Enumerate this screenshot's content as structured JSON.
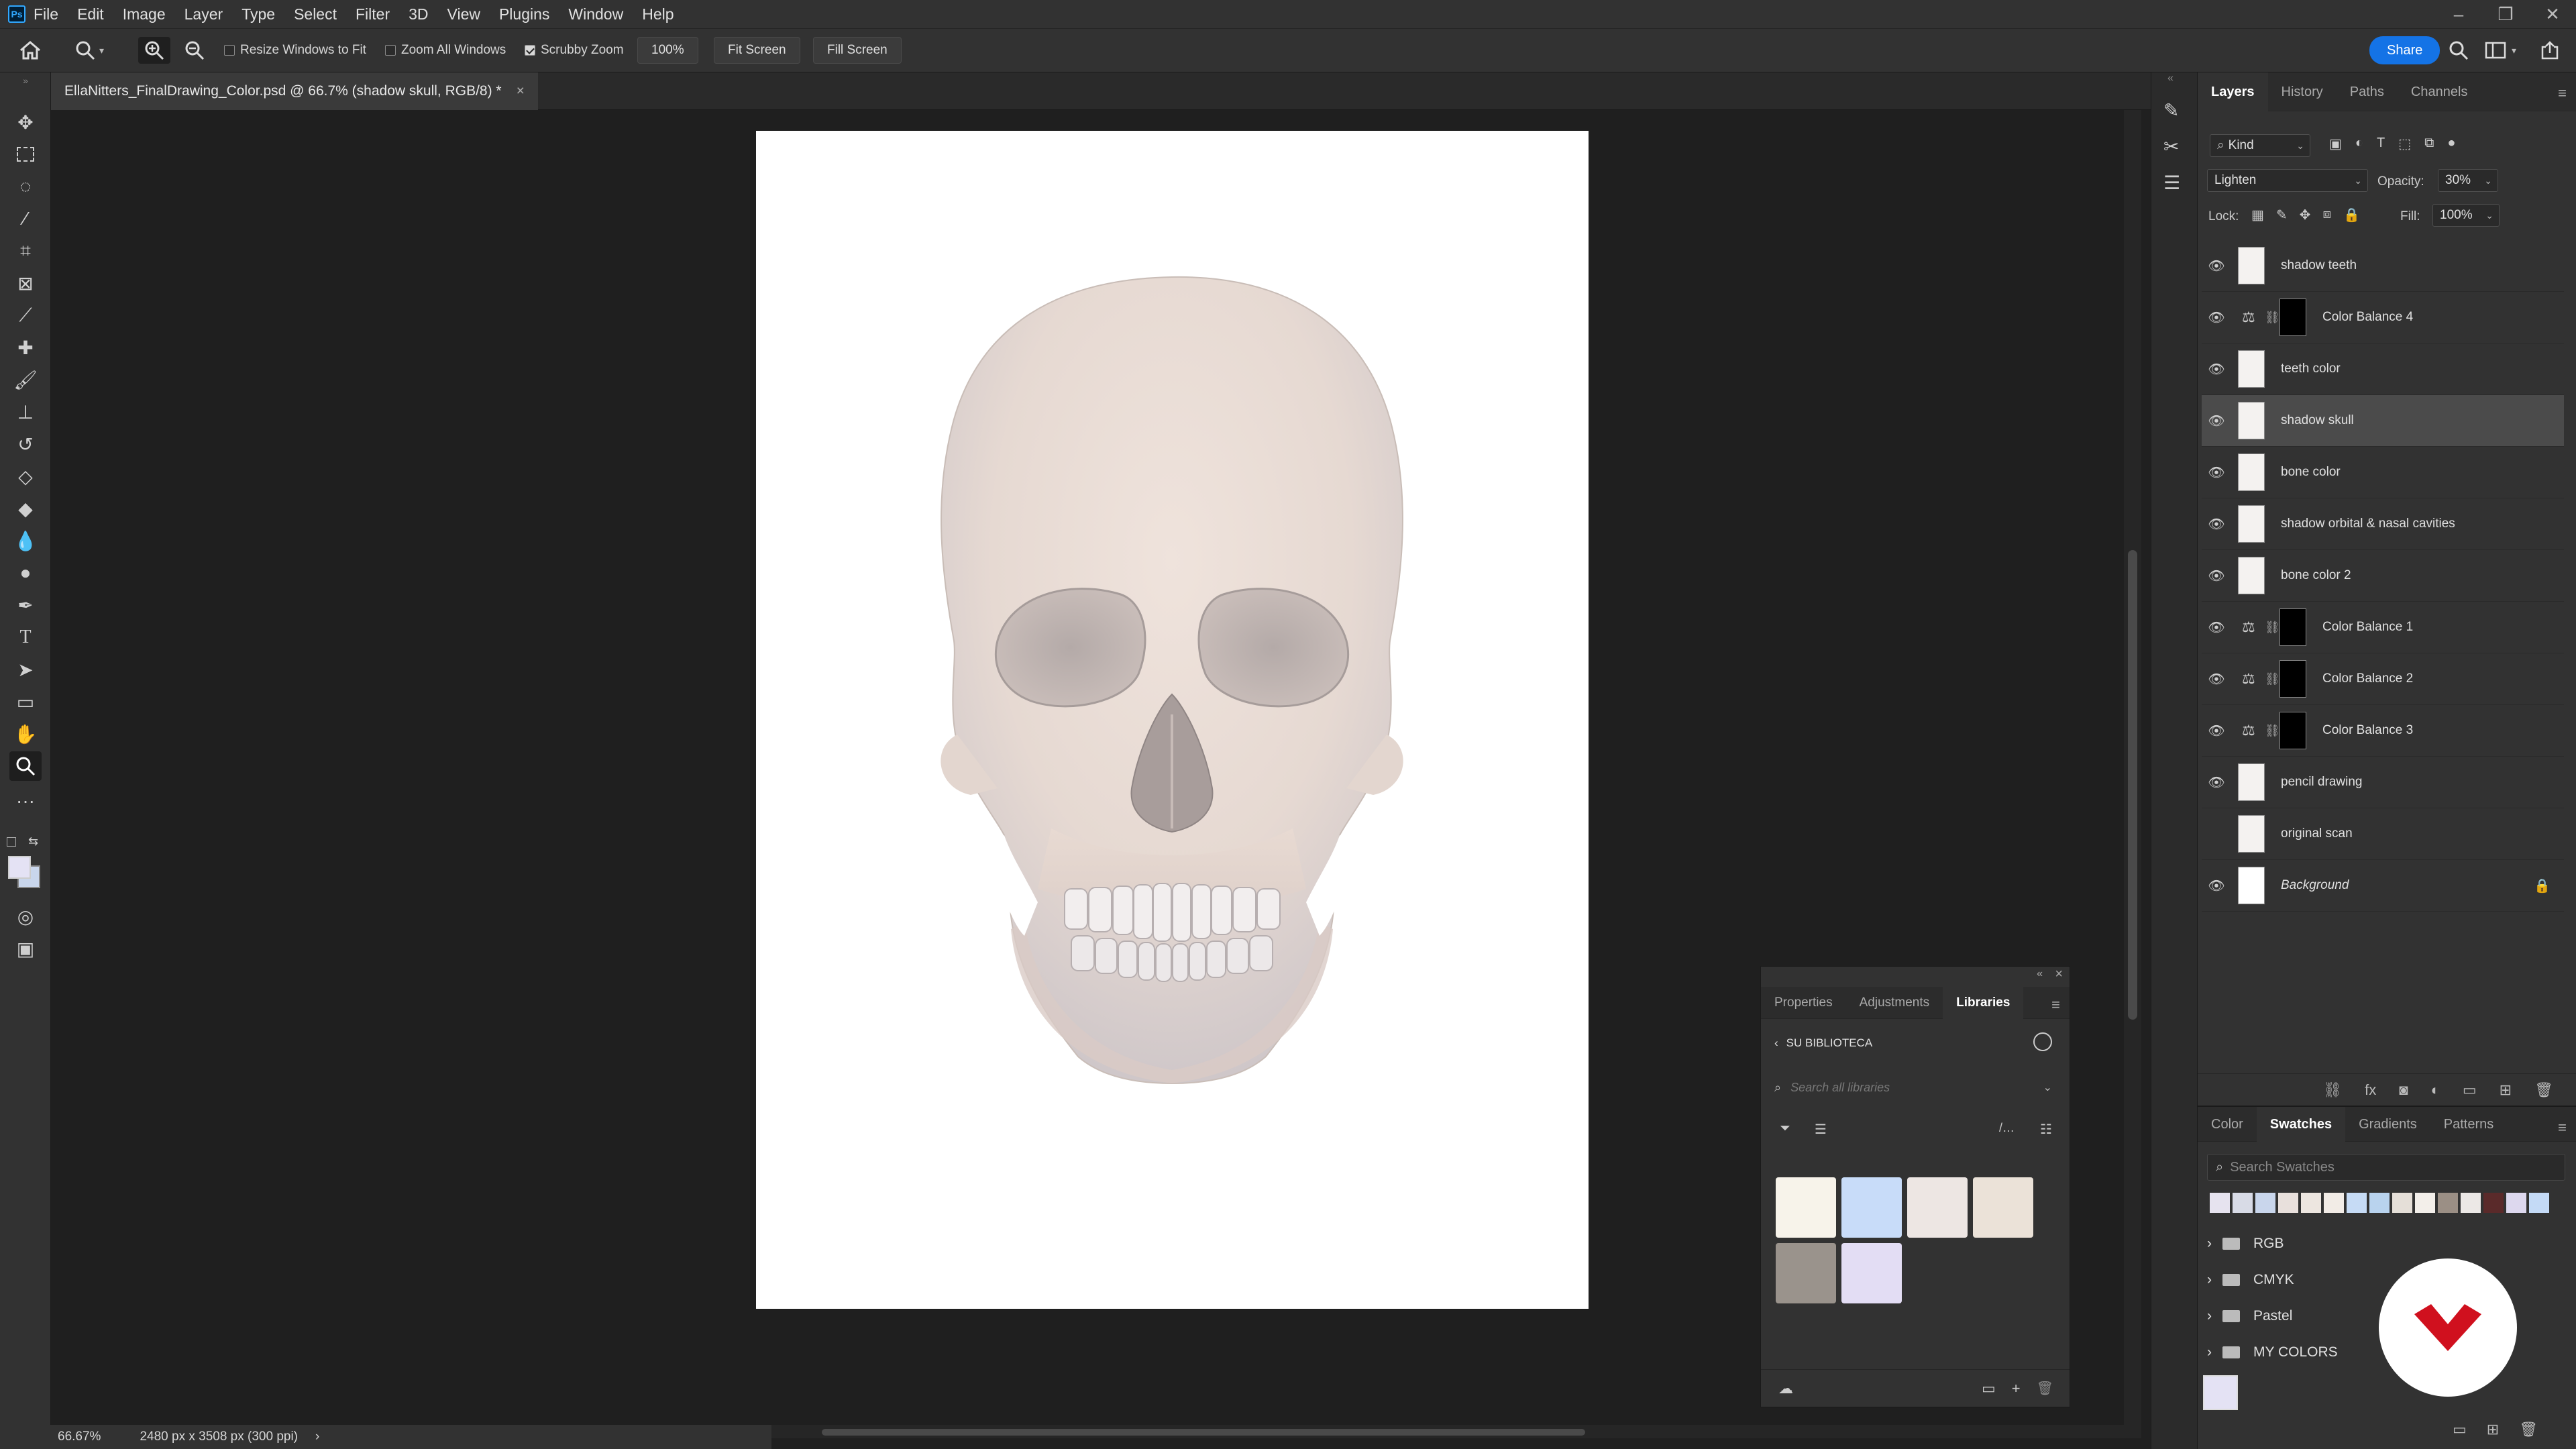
{
  "menu": {
    "app_icon": "Ps",
    "items": [
      "File",
      "Edit",
      "Image",
      "Layer",
      "Type",
      "Select",
      "Filter",
      "3D",
      "View",
      "Plugins",
      "Window",
      "Help"
    ],
    "window_controls": [
      "–",
      "❐",
      "✕"
    ]
  },
  "options_bar": {
    "resize_windows": "Resize Windows to Fit",
    "zoom_all": "Zoom All Windows",
    "scrubby_zoom": "Scrubby Zoom",
    "zoom_value": "100%",
    "fit_screen": "Fit Screen",
    "fill_screen": "Fill Screen",
    "share": "Share"
  },
  "document": {
    "tab_title": "EllaNitters_FinalDrawing_Color.psd @ 66.7% (shadow skull, RGB/8) *",
    "close": "×"
  },
  "status": {
    "zoom": "66.67%",
    "doc_size": "2480 px x 3508 px (300 ppi)",
    "arrow": "›"
  },
  "layers_panel": {
    "tabs": [
      "Layers",
      "History",
      "Paths",
      "Channels"
    ],
    "filter_kind": "Kind",
    "blend_mode": "Lighten",
    "opacity_label": "Opacity:",
    "opacity_value": "30%",
    "lock_label": "Lock:",
    "fill_label": "Fill:",
    "fill_value": "100%",
    "layers": [
      {
        "name": "shadow teeth",
        "visible": true,
        "type": "pixel"
      },
      {
        "name": "Color Balance 4",
        "visible": true,
        "type": "adjustment"
      },
      {
        "name": "teeth color",
        "visible": true,
        "type": "pixel"
      },
      {
        "name": "shadow skull",
        "visible": true,
        "type": "pixel",
        "selected": true
      },
      {
        "name": "bone color",
        "visible": true,
        "type": "pixel"
      },
      {
        "name": "shadow orbital & nasal cavities",
        "visible": true,
        "type": "pixel"
      },
      {
        "name": "bone color 2",
        "visible": true,
        "type": "pixel"
      },
      {
        "name": "Color Balance 1",
        "visible": true,
        "type": "adjustment"
      },
      {
        "name": "Color Balance 2",
        "visible": true,
        "type": "adjustment"
      },
      {
        "name": "Color Balance 3",
        "visible": true,
        "type": "adjustment"
      },
      {
        "name": "pencil drawing",
        "visible": true,
        "type": "pixel"
      },
      {
        "name": "original scan",
        "visible": false,
        "type": "pixel"
      },
      {
        "name": "Background",
        "visible": true,
        "type": "background",
        "locked": true
      }
    ]
  },
  "swatches_panel": {
    "tabs": [
      "Color",
      "Swatches",
      "Gradients",
      "Patterns"
    ],
    "search_placeholder": "Search Swatches",
    "recent_colors": [
      "#e6e3ef",
      "#d8dbe6",
      "#c9d6ec",
      "#e8e0dc",
      "#ede6e0",
      "#f2ece6",
      "#c6dbf5",
      "#b9d3ee",
      "#e5dfd8",
      "#f3efea",
      "#9b8f85",
      "#ece8e6",
      "#5a2a2a",
      "#ddd8ee",
      "#c4daf6"
    ],
    "folders": [
      "RGB",
      "CMYK",
      "Pastel",
      "MY COLORS"
    ],
    "fg_color": "#e4e2f4"
  },
  "libraries_panel": {
    "tabs": [
      "Properties",
      "Adjustments",
      "Libraries"
    ],
    "library_name": "SU BIBLIOTECA",
    "search_placeholder": "Search all libraries",
    "swatches": [
      "#f7f3ea",
      "#c8dcf9",
      "#ede6e3",
      "#ebe2d8",
      "#9a938c",
      "#e3ddf4"
    ]
  },
  "colors": {
    "accent": "#1473e6",
    "logo_red": "#d0101e",
    "fg_swatch": "#e4e2f4",
    "bg_swatch": "#c9d6ec"
  }
}
